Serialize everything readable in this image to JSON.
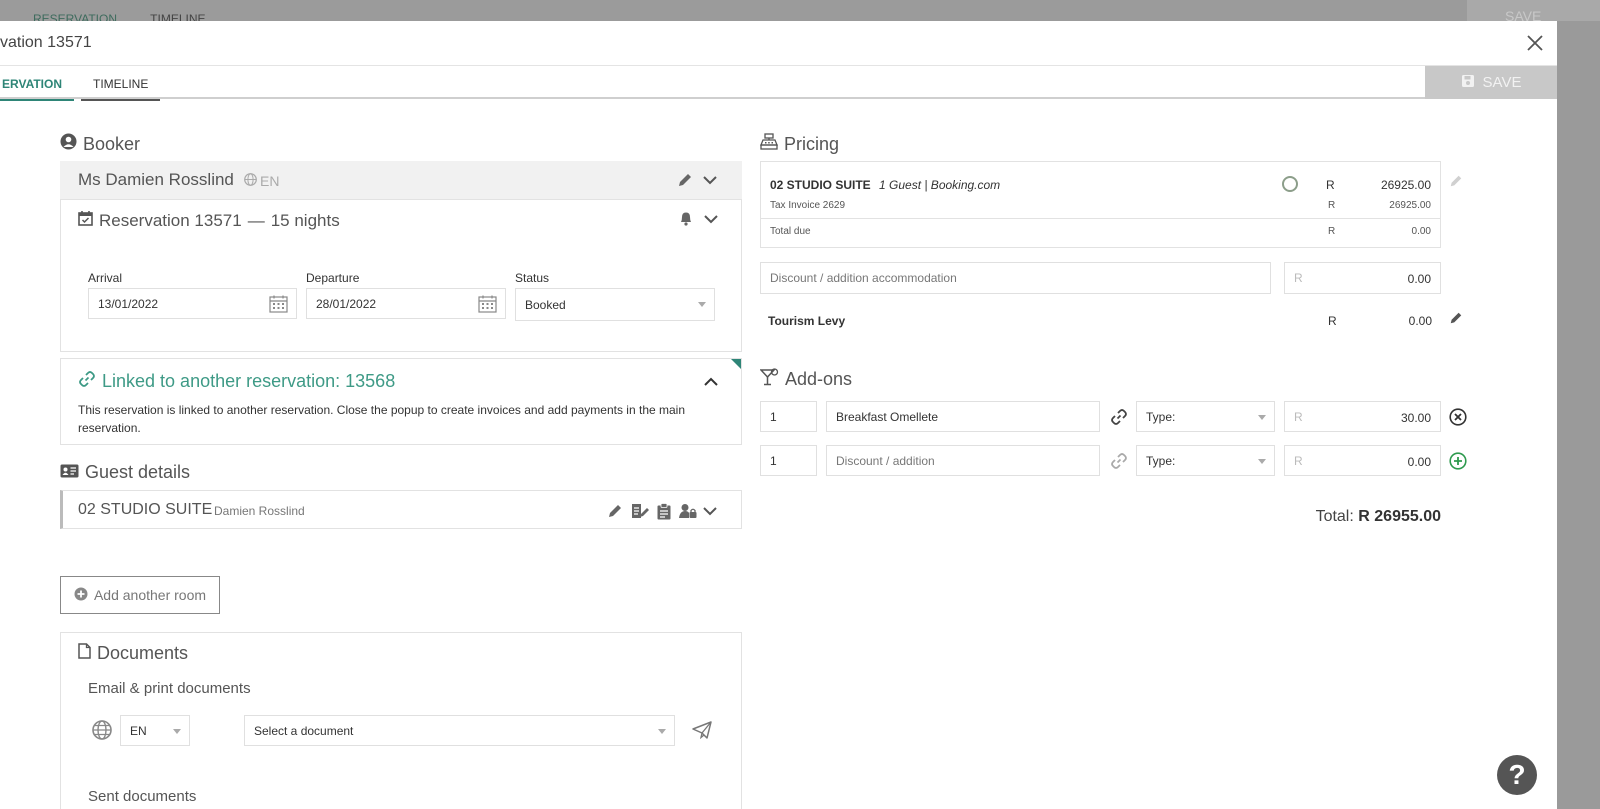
{
  "background": {
    "tabs": [
      "RESERVATION",
      "TIMELINE"
    ],
    "save_label": "SAVE"
  },
  "modal": {
    "title": "vation 13571",
    "tabs": [
      {
        "label": "ERVATION",
        "active": true
      },
      {
        "label": "TIMELINE",
        "active": false
      }
    ],
    "save_label": "SAVE"
  },
  "booker": {
    "heading": "Booker",
    "name": "Ms Damien Rosslind",
    "language": "EN"
  },
  "reservation": {
    "title": "Reservation 13571",
    "dash": "—",
    "nights": "15 nights",
    "arrival_label": "Arrival",
    "arrival_value": "13/01/2022",
    "departure_label": "Departure",
    "departure_value": "28/01/2022",
    "status_label": "Status",
    "status_value": "Booked"
  },
  "linked": {
    "heading": "Linked to another reservation: 13568",
    "message": "This reservation is linked to another reservation. Close the popup to create invoices and add payments in the main reservation."
  },
  "guest_details": {
    "heading": "Guest details",
    "room": "02 STUDIO SUITE",
    "guest_name": "Damien Rosslind",
    "add_room_label": "Add another room"
  },
  "documents": {
    "heading": "Documents",
    "email_print_label": "Email & print documents",
    "language": "EN",
    "document_placeholder": "Select a document",
    "sent_label": "Sent documents"
  },
  "pricing": {
    "heading": "Pricing",
    "room": "02 STUDIO SUITE",
    "room_details": "1 Guest | Booking.com",
    "currency": "R",
    "room_amount": "26925.00",
    "tax_invoice_label": "Tax Invoice 2629",
    "tax_invoice_amount": "26925.00",
    "total_due_label": "Total due",
    "total_due_amount": "0.00",
    "discount_placeholder": "Discount / addition accommodation",
    "discount_amount": "0.00",
    "tourism_levy_label": "Tourism Levy",
    "tourism_levy_amount": "0.00"
  },
  "addons": {
    "heading": "Add-ons",
    "rows": [
      {
        "qty": "1",
        "name": "Breakfast Omellete",
        "type": "Type:",
        "currency": "R",
        "amount": "30.00"
      },
      {
        "qty": "1",
        "name": "Discount / addition",
        "type": "Type:",
        "currency": "R",
        "amount": "0.00"
      }
    ],
    "total_label": "Total:",
    "total_value": "R 26955.00"
  },
  "colors": {
    "accent": "#2e8577",
    "linked_heading": "#3e9a86",
    "add_green": "#2e9a4e"
  }
}
